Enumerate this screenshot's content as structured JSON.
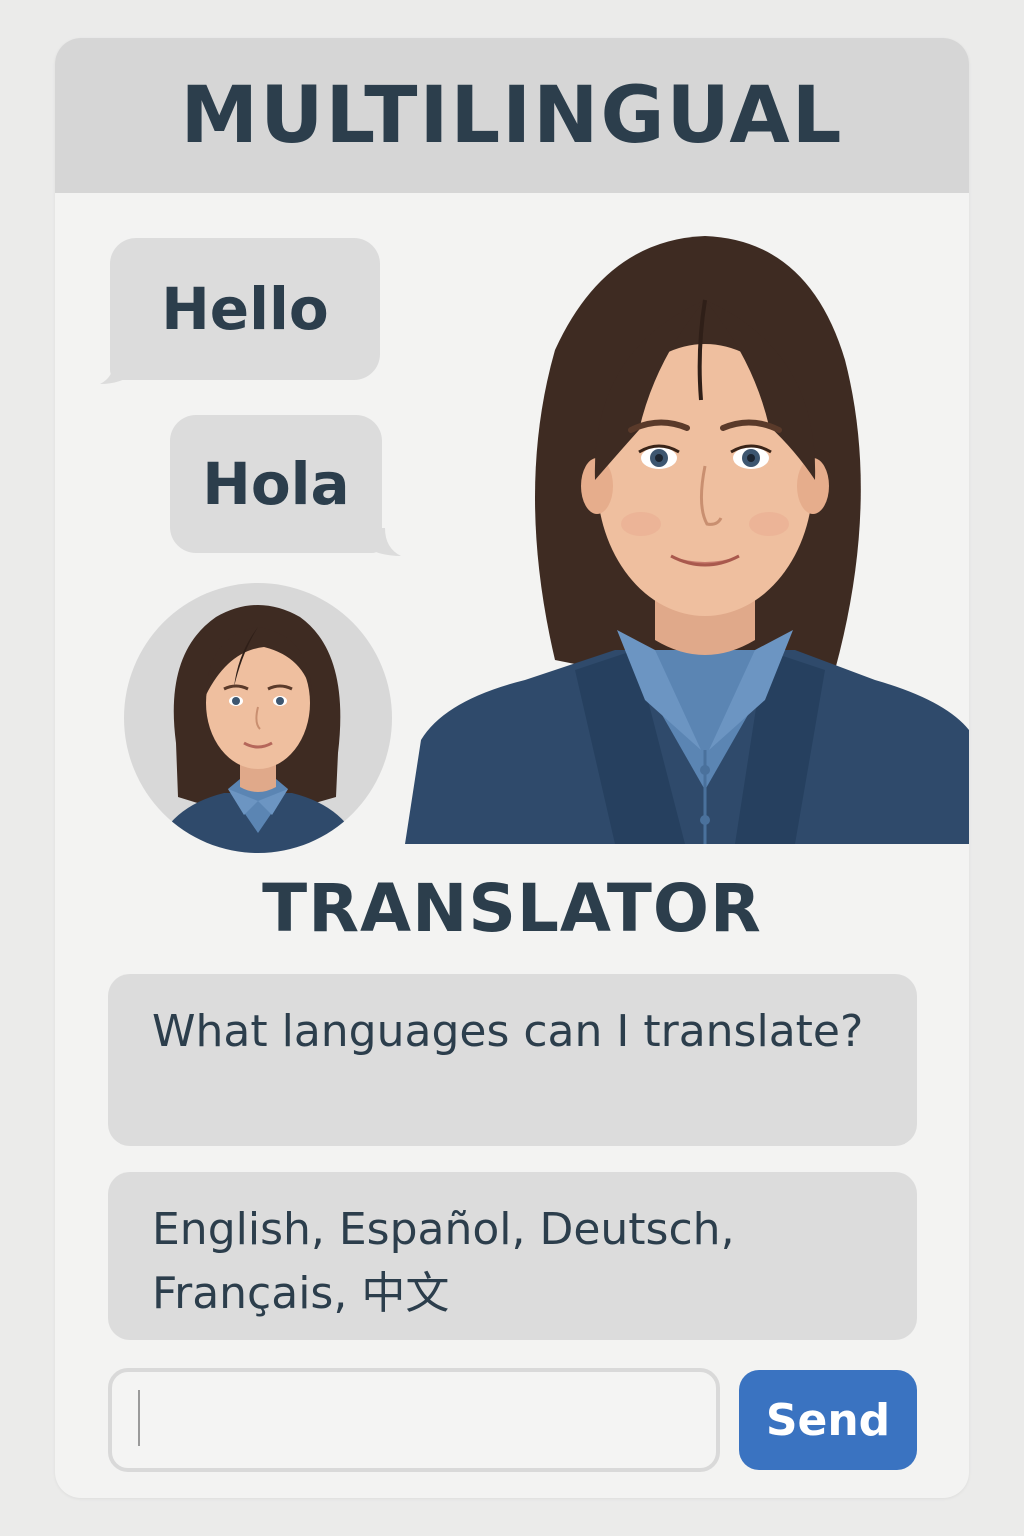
{
  "colors": {
    "background": "#ebebea",
    "card": "#f3f3f2",
    "header": "#d6d6d6",
    "bubble": "#dcdcdc",
    "text": "#2c3e4c",
    "accent": "#3a73c1"
  },
  "header": {
    "title": "MULTILINGUAL"
  },
  "greetings": [
    {
      "text": "Hello"
    },
    {
      "text": "Hola"
    }
  ],
  "assistant": {
    "avatar_icon": "woman-avatar-icon",
    "portrait_icon": "woman-portrait-illustration",
    "title": "TRANSLATOR"
  },
  "conversation": {
    "question": "What languages can I translate?",
    "answer": "English, Español, Deutsch, Français, 中文"
  },
  "composer": {
    "input_value": "",
    "input_placeholder": "",
    "send_label": "Send"
  }
}
